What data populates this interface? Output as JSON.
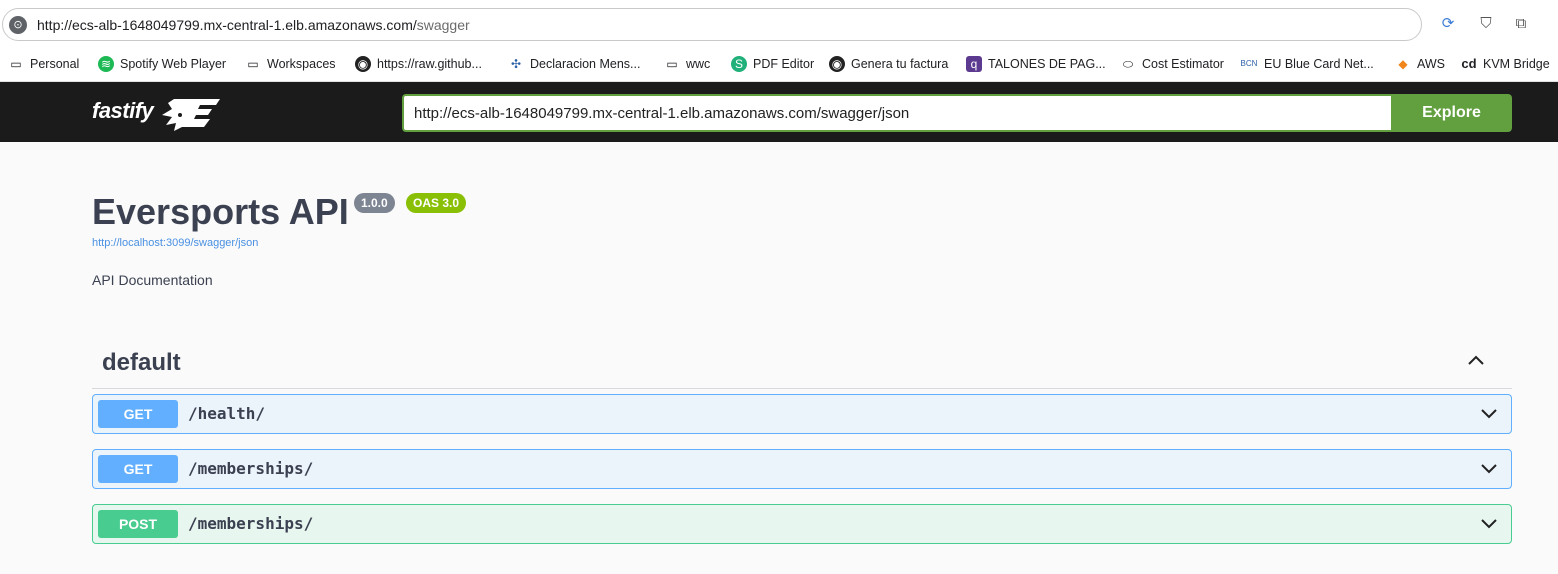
{
  "browser": {
    "url_main": "http://ecs-alb-1648049799.mx-central-1.elb.amazonaws.com/",
    "url_path": "swagger",
    "bookmarks": [
      {
        "label": "Personal",
        "icon": "folder-icon"
      },
      {
        "label": "Spotify Web Player",
        "icon": "spotify-icon"
      },
      {
        "label": "Workspaces",
        "icon": "folder-icon"
      },
      {
        "label": "https://raw.github...",
        "icon": "github-icon"
      },
      {
        "label": "Declaracion Mens...",
        "icon": "sat-icon"
      },
      {
        "label": "wwc",
        "icon": "folder-icon"
      },
      {
        "label": "PDF Editor",
        "icon": "pdf-editor-icon"
      },
      {
        "label": "Genera tu factura",
        "icon": "globe-icon"
      },
      {
        "label": "TALONES DE PAG...",
        "icon": "talones-icon"
      },
      {
        "label": "Cost Estimator",
        "icon": "cost-estimator-icon"
      },
      {
        "label": "EU Blue Card Net...",
        "icon": "bcn-icon"
      },
      {
        "label": "AWS",
        "icon": "aws-icon"
      },
      {
        "label": "KVM Bridge",
        "icon": "cd-icon"
      }
    ]
  },
  "topbar": {
    "logo_text": "fastify",
    "url_value": "http://ecs-alb-1648049799.mx-central-1.elb.amazonaws.com/swagger/json",
    "explore_label": "Explore"
  },
  "info": {
    "title": "Eversports API",
    "version": "1.0.0",
    "oas": "OAS 3.0",
    "spec_url": "http://localhost:3099/swagger/json",
    "description": "API Documentation"
  },
  "tag": {
    "name": "default",
    "operations": [
      {
        "method": "GET",
        "path": "/health/"
      },
      {
        "method": "GET",
        "path": "/memberships/"
      },
      {
        "method": "POST",
        "path": "/memberships/"
      }
    ]
  },
  "colors": {
    "get": "#61affe",
    "post": "#49cc90",
    "explore": "#62a03f"
  }
}
